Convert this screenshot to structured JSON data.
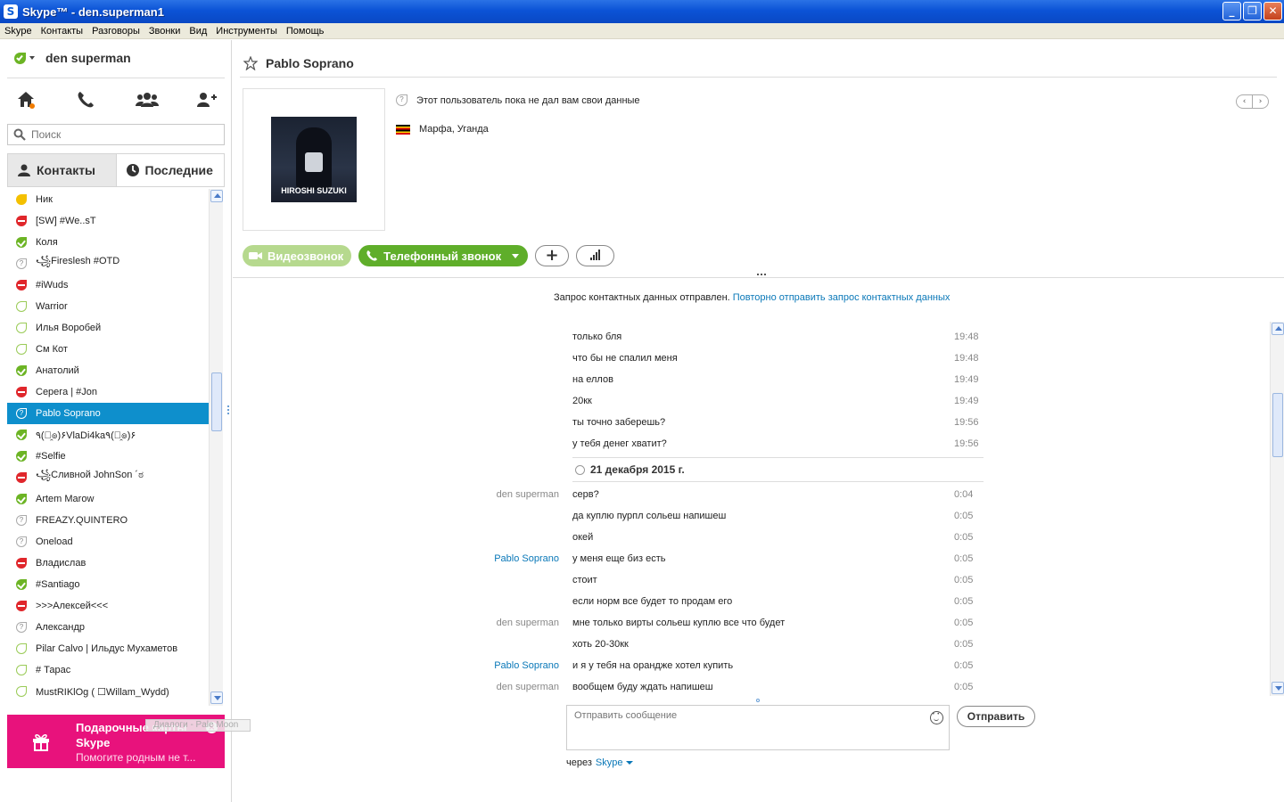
{
  "window": {
    "title": "Skype™ - den.superman1",
    "app_icon": "S",
    "minimize": "_",
    "maximize": "❐",
    "close": "✕"
  },
  "menu": [
    "Skype",
    "Контакты",
    "Разговоры",
    "Звонки",
    "Вид",
    "Инструменты",
    "Помощь"
  ],
  "profile": {
    "name": "den superman",
    "status": "online",
    "status_color": "#6cb424"
  },
  "nav_icons": [
    "home-icon",
    "phone-icon",
    "group-icon",
    "add-contact-icon"
  ],
  "search": {
    "placeholder": "Поиск"
  },
  "tabs": {
    "contacts": "Контакты",
    "recent": "Последние"
  },
  "contacts": [
    {
      "name": "Ник",
      "status": "away"
    },
    {
      "name": "[SW] #We..sT",
      "status": "dnd"
    },
    {
      "name": "Коля",
      "status": "online"
    },
    {
      "name": "꧁Fireslesh #OTD",
      "status": "unknown"
    },
    {
      "name": "#iWuds",
      "status": "dnd"
    },
    {
      "name": "Warrior",
      "status": "offline"
    },
    {
      "name": "Илья Воробей",
      "status": "offline"
    },
    {
      "name": "См Кот",
      "status": "offline"
    },
    {
      "name": "Анатолий",
      "status": "online"
    },
    {
      "name": "Серега | #Jon",
      "status": "dnd"
    },
    {
      "name": "Pablo Soprano",
      "status": "unknown",
      "selected": true
    },
    {
      "name": "٩(๏̯๏)۶VlaDi4ka٩(๏̯๏)۶",
      "status": "online"
    },
    {
      "name": "#Selfie",
      "status": "online"
    },
    {
      "name": "꧁Сливной JohnSon ´ಠ",
      "status": "dnd"
    },
    {
      "name": "Artem Marow",
      "status": "online"
    },
    {
      "name": "FREAZY.QUINTERO",
      "status": "unknown"
    },
    {
      "name": "Oneload",
      "status": "unknown"
    },
    {
      "name": "Владислав",
      "status": "dnd"
    },
    {
      "name": "#Santiago",
      "status": "online"
    },
    {
      "name": ">>>Алексей<<<",
      "status": "dnd"
    },
    {
      "name": "Александр",
      "status": "unknown"
    },
    {
      "name": "Pilar Calvo | Ильдус Мухаметов",
      "status": "offline"
    },
    {
      "name": "# Тарас",
      "status": "offline"
    },
    {
      "name": "MustRIKlOg ( ☐Willam_Wydd)",
      "status": "offline"
    }
  ],
  "promo": {
    "title": "Подарочные карты Skype",
    "subtitle": "Помогите родным не т...",
    "close": "×"
  },
  "ghost_tooltip": "Диалоги - Pale Moon",
  "conversation": {
    "name": "Pablo Soprano",
    "avatar_caption": "HIROSHI SUZUKI",
    "info_text": "Этот пользователь пока не дал вам свои данные",
    "location": "Марфа, Уганда",
    "pager_prev": "‹",
    "pager_next": "›",
    "video_call": "Видеозвонок",
    "phone_call": "Телефонный звонок",
    "add_button": "+",
    "notice_text": "Запрос контактных данных отправлен.",
    "notice_link": "Повторно отправить запрос контактных данных",
    "date_separator": "21 декабря 2015 г.",
    "messages_before": [
      {
        "author": "",
        "text": "только бля",
        "time": "19:48"
      },
      {
        "author": "",
        "text": "что бы не спалил меня",
        "time": "19:48"
      },
      {
        "author": "",
        "text": "на еллов",
        "time": "19:49"
      },
      {
        "author": "",
        "text": "20кк",
        "time": "19:49"
      },
      {
        "author": "",
        "text": "ты точно заберешь?",
        "time": "19:56"
      },
      {
        "author": "",
        "text": "у тебя денег хватит?",
        "time": "19:56"
      }
    ],
    "messages_after": [
      {
        "author": "den superman",
        "self": true,
        "text": "серв?",
        "time": "0:04"
      },
      {
        "author": "",
        "text": "да куплю пурпл сольеш напишеш",
        "time": "0:05"
      },
      {
        "author": "",
        "text": "окей",
        "time": "0:05"
      },
      {
        "author": "Pablo Soprano",
        "self": false,
        "text": "у меня еще биз есть",
        "time": "0:05"
      },
      {
        "author": "",
        "text": "стоит",
        "time": "0:05"
      },
      {
        "author": "",
        "text": "если норм все будет то продам его",
        "time": "0:05"
      },
      {
        "author": "den superman",
        "self": true,
        "text": "мне только вирты сольеш куплю все что будет",
        "time": "0:05"
      },
      {
        "author": "",
        "text": "хоть 20-30кк",
        "time": "0:05"
      },
      {
        "author": "Pablo Soprano",
        "self": false,
        "text": "и я у тебя на орандже хотел купить",
        "time": "0:05"
      },
      {
        "author": "den superman",
        "self": true,
        "text": "вообщем буду ждать напишеш",
        "time": "0:05"
      }
    ],
    "composer_placeholder": "Отправить сообщение",
    "send_button": "Отправить",
    "via_label": "через",
    "via_service": "Skype"
  },
  "colors": {
    "accent": "#0e8fcc",
    "link": "#0a78b8",
    "call_green": "#5fae2a",
    "promo": "#e8127c"
  }
}
